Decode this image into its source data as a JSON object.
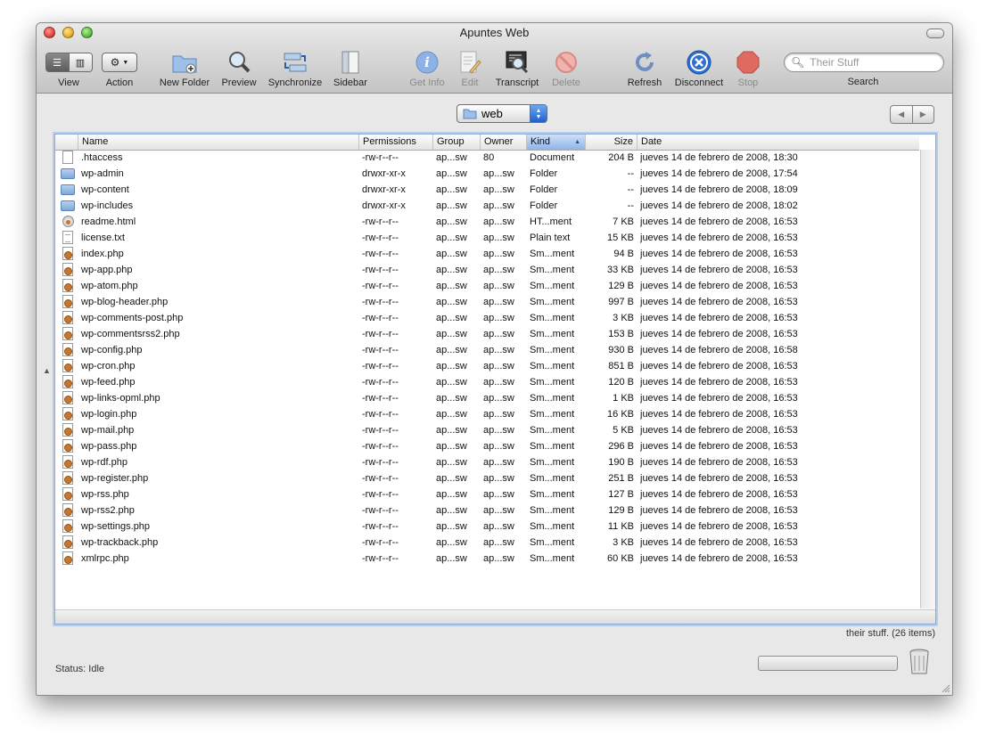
{
  "window": {
    "title": "Apuntes Web"
  },
  "toolbar": {
    "view_label": "View",
    "action_label": "Action",
    "new_folder_label": "New Folder",
    "preview_label": "Preview",
    "synchronize_label": "Synchronize",
    "sidebar_label": "Sidebar",
    "get_info_label": "Get Info",
    "edit_label": "Edit",
    "transcript_label": "Transcript",
    "delete_label": "Delete",
    "refresh_label": "Refresh",
    "disconnect_label": "Disconnect",
    "stop_label": "Stop",
    "search_label": "Search",
    "search_placeholder": "Their Stuff"
  },
  "location": {
    "folder": "web"
  },
  "columns": {
    "name": "Name",
    "permissions": "Permissions",
    "group": "Group",
    "owner": "Owner",
    "kind": "Kind",
    "size": "Size",
    "date": "Date"
  },
  "sort_column": "Kind",
  "files": [
    {
      "icon": "doc",
      "name": ".htaccess",
      "perm": "-rw-r--r--",
      "group": "ap...sw",
      "owner": "80",
      "kind": "Document",
      "size": "204 B",
      "date": "jueves 14 de febrero de 2008, 18:30"
    },
    {
      "icon": "folder",
      "name": "wp-admin",
      "perm": "drwxr-xr-x",
      "group": "ap...sw",
      "owner": "ap...sw",
      "kind": "Folder",
      "size": "--",
      "date": "jueves 14 de febrero de 2008, 17:54"
    },
    {
      "icon": "folder",
      "name": "wp-content",
      "perm": "drwxr-xr-x",
      "group": "ap...sw",
      "owner": "ap...sw",
      "kind": "Folder",
      "size": "--",
      "date": "jueves 14 de febrero de 2008, 18:09"
    },
    {
      "icon": "folder",
      "name": "wp-includes",
      "perm": "drwxr-xr-x",
      "group": "ap...sw",
      "owner": "ap...sw",
      "kind": "Folder",
      "size": "--",
      "date": "jueves 14 de febrero de 2008, 18:02"
    },
    {
      "icon": "html",
      "name": "readme.html",
      "perm": "-rw-r--r--",
      "group": "ap...sw",
      "owner": "ap...sw",
      "kind": "HT...ment",
      "size": "7 KB",
      "date": "jueves 14 de febrero de 2008, 16:53"
    },
    {
      "icon": "text",
      "name": "license.txt",
      "perm": "-rw-r--r--",
      "group": "ap...sw",
      "owner": "ap...sw",
      "kind": "Plain text",
      "size": "15 KB",
      "date": "jueves 14 de febrero de 2008, 16:53"
    },
    {
      "icon": "php",
      "name": "index.php",
      "perm": "-rw-r--r--",
      "group": "ap...sw",
      "owner": "ap...sw",
      "kind": "Sm...ment",
      "size": "94 B",
      "date": "jueves 14 de febrero de 2008, 16:53"
    },
    {
      "icon": "php",
      "name": "wp-app.php",
      "perm": "-rw-r--r--",
      "group": "ap...sw",
      "owner": "ap...sw",
      "kind": "Sm...ment",
      "size": "33 KB",
      "date": "jueves 14 de febrero de 2008, 16:53"
    },
    {
      "icon": "php",
      "name": "wp-atom.php",
      "perm": "-rw-r--r--",
      "group": "ap...sw",
      "owner": "ap...sw",
      "kind": "Sm...ment",
      "size": "129 B",
      "date": "jueves 14 de febrero de 2008, 16:53"
    },
    {
      "icon": "php",
      "name": "wp-blog-header.php",
      "perm": "-rw-r--r--",
      "group": "ap...sw",
      "owner": "ap...sw",
      "kind": "Sm...ment",
      "size": "997 B",
      "date": "jueves 14 de febrero de 2008, 16:53"
    },
    {
      "icon": "php",
      "name": "wp-comments-post.php",
      "perm": "-rw-r--r--",
      "group": "ap...sw",
      "owner": "ap...sw",
      "kind": "Sm...ment",
      "size": "3 KB",
      "date": "jueves 14 de febrero de 2008, 16:53"
    },
    {
      "icon": "php",
      "name": "wp-commentsrss2.php",
      "perm": "-rw-r--r--",
      "group": "ap...sw",
      "owner": "ap...sw",
      "kind": "Sm...ment",
      "size": "153 B",
      "date": "jueves 14 de febrero de 2008, 16:53"
    },
    {
      "icon": "php",
      "name": "wp-config.php",
      "perm": "-rw-r--r--",
      "group": "ap...sw",
      "owner": "ap...sw",
      "kind": "Sm...ment",
      "size": "930 B",
      "date": "jueves 14 de febrero de 2008, 16:58"
    },
    {
      "icon": "php",
      "name": "wp-cron.php",
      "perm": "-rw-r--r--",
      "group": "ap...sw",
      "owner": "ap...sw",
      "kind": "Sm...ment",
      "size": "851 B",
      "date": "jueves 14 de febrero de 2008, 16:53"
    },
    {
      "icon": "php",
      "name": "wp-feed.php",
      "perm": "-rw-r--r--",
      "group": "ap...sw",
      "owner": "ap...sw",
      "kind": "Sm...ment",
      "size": "120 B",
      "date": "jueves 14 de febrero de 2008, 16:53"
    },
    {
      "icon": "php",
      "name": "wp-links-opml.php",
      "perm": "-rw-r--r--",
      "group": "ap...sw",
      "owner": "ap...sw",
      "kind": "Sm...ment",
      "size": "1 KB",
      "date": "jueves 14 de febrero de 2008, 16:53"
    },
    {
      "icon": "php",
      "name": "wp-login.php",
      "perm": "-rw-r--r--",
      "group": "ap...sw",
      "owner": "ap...sw",
      "kind": "Sm...ment",
      "size": "16 KB",
      "date": "jueves 14 de febrero de 2008, 16:53"
    },
    {
      "icon": "php",
      "name": "wp-mail.php",
      "perm": "-rw-r--r--",
      "group": "ap...sw",
      "owner": "ap...sw",
      "kind": "Sm...ment",
      "size": "5 KB",
      "date": "jueves 14 de febrero de 2008, 16:53"
    },
    {
      "icon": "php",
      "name": "wp-pass.php",
      "perm": "-rw-r--r--",
      "group": "ap...sw",
      "owner": "ap...sw",
      "kind": "Sm...ment",
      "size": "296 B",
      "date": "jueves 14 de febrero de 2008, 16:53"
    },
    {
      "icon": "php",
      "name": "wp-rdf.php",
      "perm": "-rw-r--r--",
      "group": "ap...sw",
      "owner": "ap...sw",
      "kind": "Sm...ment",
      "size": "190 B",
      "date": "jueves 14 de febrero de 2008, 16:53"
    },
    {
      "icon": "php",
      "name": "wp-register.php",
      "perm": "-rw-r--r--",
      "group": "ap...sw",
      "owner": "ap...sw",
      "kind": "Sm...ment",
      "size": "251 B",
      "date": "jueves 14 de febrero de 2008, 16:53"
    },
    {
      "icon": "php",
      "name": "wp-rss.php",
      "perm": "-rw-r--r--",
      "group": "ap...sw",
      "owner": "ap...sw",
      "kind": "Sm...ment",
      "size": "127 B",
      "date": "jueves 14 de febrero de 2008, 16:53"
    },
    {
      "icon": "php",
      "name": "wp-rss2.php",
      "perm": "-rw-r--r--",
      "group": "ap...sw",
      "owner": "ap...sw",
      "kind": "Sm...ment",
      "size": "129 B",
      "date": "jueves 14 de febrero de 2008, 16:53"
    },
    {
      "icon": "php",
      "name": "wp-settings.php",
      "perm": "-rw-r--r--",
      "group": "ap...sw",
      "owner": "ap...sw",
      "kind": "Sm...ment",
      "size": "11 KB",
      "date": "jueves 14 de febrero de 2008, 16:53"
    },
    {
      "icon": "php",
      "name": "wp-trackback.php",
      "perm": "-rw-r--r--",
      "group": "ap...sw",
      "owner": "ap...sw",
      "kind": "Sm...ment",
      "size": "3 KB",
      "date": "jueves 14 de febrero de 2008, 16:53"
    },
    {
      "icon": "php",
      "name": "xmlrpc.php",
      "perm": "-rw-r--r--",
      "group": "ap...sw",
      "owner": "ap...sw",
      "kind": "Sm...ment",
      "size": "60 KB",
      "date": "jueves 14 de febrero de 2008, 16:53"
    }
  ],
  "footer": {
    "item_count": "their stuff. (26 items)",
    "status": "Status: Idle"
  },
  "colors": {
    "accent": "#3f7fd9",
    "close": "#e2463f",
    "minimize": "#e9b22b",
    "zoom": "#5fbb46"
  }
}
